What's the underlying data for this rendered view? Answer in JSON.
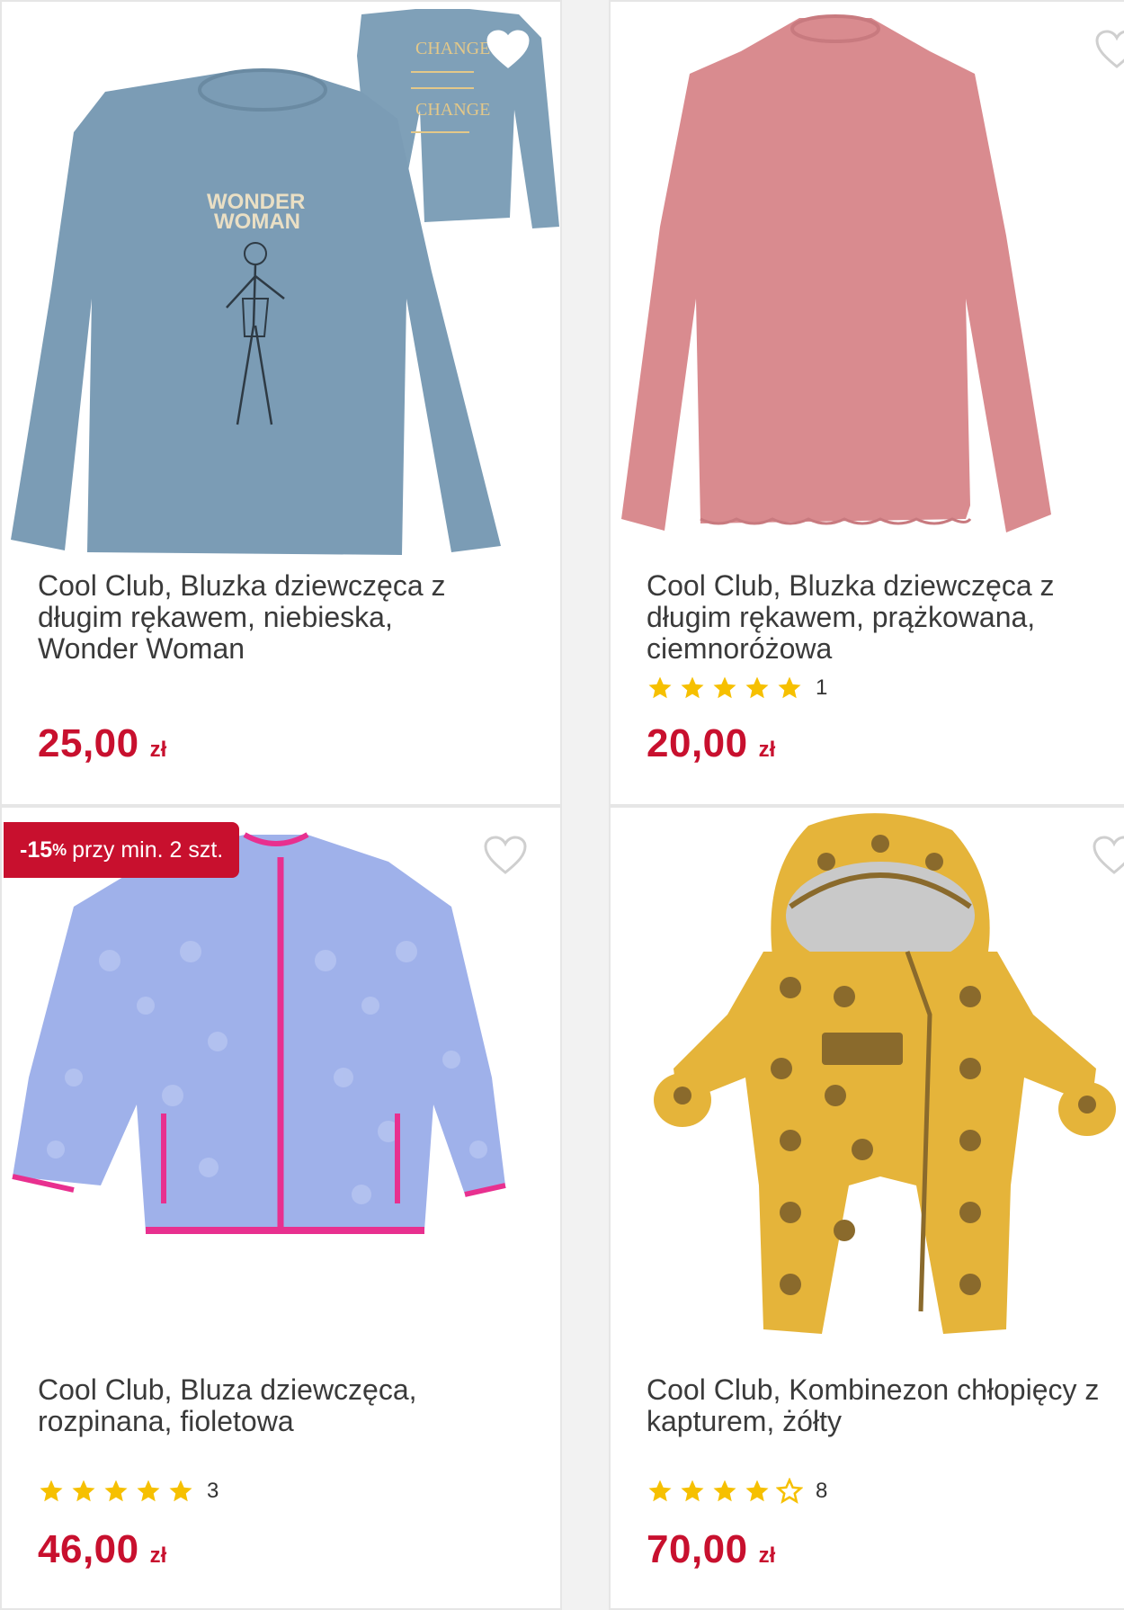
{
  "products": [
    {
      "title": "Cool Club, Bluzka dziewczęca z długim rękawem, niebieska, Wonder Woman",
      "title_lines": [
        "Cool Club, Bluzka dziewczęca z",
        "długim rękawem, niebieska,",
        "Wonder Woman"
      ],
      "price": "25,00",
      "currency": "zł",
      "rating_stars": null,
      "rating_count": null,
      "image": "blue-wonder-woman-longsleeve",
      "print_text_1": "WONDER",
      "print_text_2": "WOMAN",
      "back_text_1": "CHANGE",
      "back_text_2": "CHANGE",
      "color": "#7d9db4"
    },
    {
      "title": "Cool Club, Bluzka dziewczęca z długim rękawem, prążkowana, ciemnoróżowa",
      "title_lines": [
        "Cool Club, Bluzka dziewczęca z",
        "długim rękawem, prążkowana,",
        "ciemnoróżowa"
      ],
      "price": "20,00",
      "currency": "zł",
      "rating_stars": 5,
      "rating_count": "1",
      "image": "pink-ribbed-longsleeve",
      "color": "#d98b8f"
    },
    {
      "title": "Cool Club, Bluza dziewczęca, rozpinana, fioletowa",
      "title_lines": [
        "Cool Club, Bluza dziewczęca,",
        "rozpinana, fioletowa"
      ],
      "price": "46,00",
      "currency": "zł",
      "rating_stars": 5,
      "rating_count": "3",
      "badge": {
        "prefix": "-15",
        "pct": "%",
        "text": "przy min. 2 szt."
      },
      "image": "lilac-sherpa-zip-jacket",
      "color": "#9fb1ea"
    },
    {
      "title": "Cool Club, Kombinezon chłopięcy z kapturem, żółty",
      "title_lines": [
        "Cool Club, Kombinezon chłopięcy z",
        "kapturem, żółty"
      ],
      "price": "70,00",
      "currency": "zł",
      "rating_stars": 4,
      "rating_count": "8",
      "image": "yellow-bear-snowsuit",
      "color": "#e5b43a"
    }
  ],
  "colors": {
    "price": "#c8102e",
    "star": "#f6c000",
    "badge_bg": "#c8102e",
    "title_text": "#3a3a3a"
  },
  "icons": {
    "wishlist": "heart-outline-icon",
    "rating": "star-icon"
  }
}
